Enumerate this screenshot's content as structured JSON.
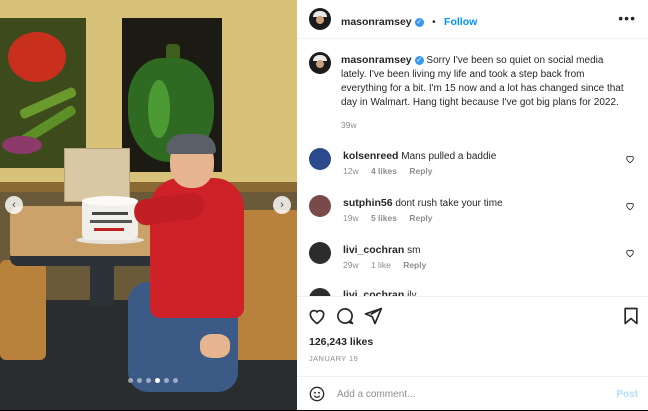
{
  "post": {
    "username": "masonramsey",
    "follow_label": "Follow",
    "caption": "Sorry I've been so quiet on social media lately. I've been living my life and took a step back from everything for a bit. I'm 15 now and a lot has changed since that day in Walmart. Hang tight because I've got big plans for 2022.",
    "caption_age": "39w",
    "likes": "126,243 likes",
    "date": "JANUARY 19",
    "photo_cake_text": "happy birthday mason",
    "carousel": {
      "total": 6,
      "active": 3
    }
  },
  "comments": [
    {
      "username": "kolsenreed",
      "text": "Mans pulled a baddie",
      "age": "12w",
      "likes": "4 likes",
      "reply": "Reply"
    },
    {
      "username": "sutphin56",
      "text": "dont rush take your time",
      "age": "19w",
      "likes": "5 likes",
      "reply": "Reply"
    },
    {
      "username": "livi_cochran",
      "text": "sm",
      "age": "29w",
      "likes": "1 like",
      "reply": "Reply"
    },
    {
      "username": "livi_cochran",
      "text": "ily"
    }
  ],
  "add_comment": {
    "placeholder": "Add a comment...",
    "post_label": "Post"
  },
  "icons": [
    "more-options-icon",
    "verified-icon",
    "heart-icon",
    "comment-icon",
    "share-icon",
    "save-icon",
    "emoji-icon",
    "chevron-left-icon",
    "chevron-right-icon"
  ],
  "colors": {
    "link_blue": "#0095f6",
    "verified_blue": "#3897f0",
    "muted": "#8e8e8e",
    "post_disabled": "#b2dffc"
  }
}
